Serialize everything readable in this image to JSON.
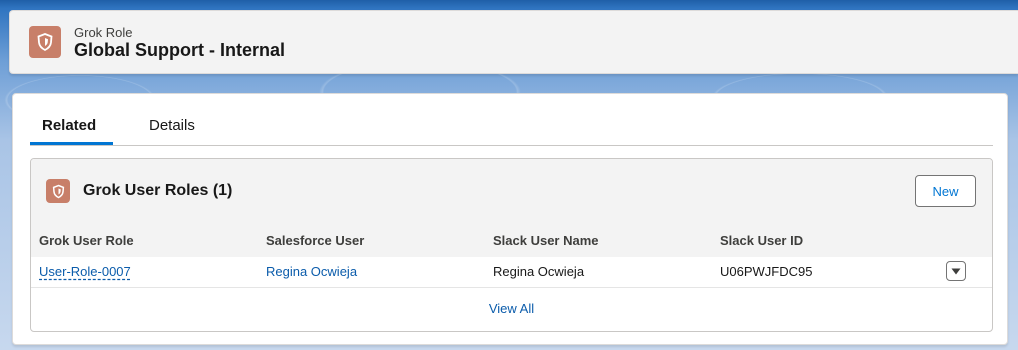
{
  "record": {
    "object_label": "Grok Role",
    "title": "Global Support - Internal",
    "icon": "shield-icon"
  },
  "tabs": [
    {
      "label": "Related",
      "active": true
    },
    {
      "label": "Details",
      "active": false
    }
  ],
  "related_list": {
    "title": "Grok User Roles (1)",
    "icon": "shield-icon",
    "new_label": "New",
    "columns": [
      "Grok User Role",
      "Salesforce User",
      "Slack User Name",
      "Slack User ID"
    ],
    "rows": [
      {
        "grok_user_role": "User-Role-0007",
        "salesforce_user": "Regina Ocwieja",
        "slack_user_name": "Regina Ocwieja",
        "slack_user_id": "U06PWJFDC95"
      }
    ],
    "view_all_label": "View All"
  },
  "colors": {
    "accent": "#0176d3",
    "link": "#0b5cab",
    "icon_bg": "#c87f69"
  }
}
